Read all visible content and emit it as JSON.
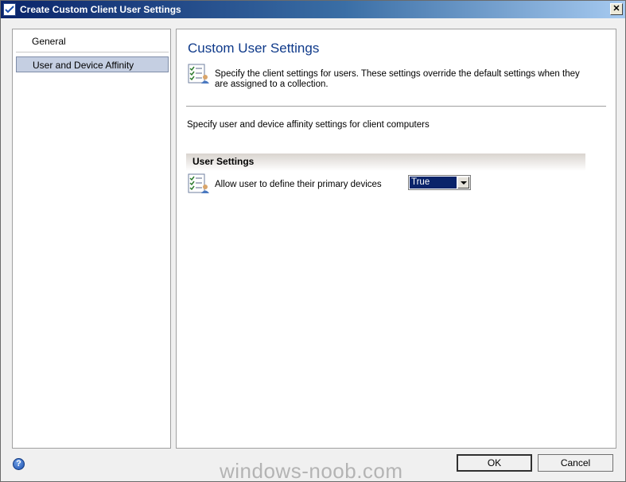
{
  "window": {
    "title": "Create Custom Client User Settings",
    "close_glyph": "✕"
  },
  "nav": {
    "items": [
      {
        "label": "General",
        "selected": false
      },
      {
        "label": "User and Device Affinity",
        "selected": true
      }
    ]
  },
  "page": {
    "title": "Custom User Settings",
    "description": "Specify the client settings for users. These settings override the default settings when they are assigned to a collection.",
    "affinity_description": "Specify user and device affinity settings for client computers"
  },
  "section": {
    "header": "User Settings",
    "settings": [
      {
        "label": "Allow user to define their primary devices",
        "value": "True"
      }
    ]
  },
  "footer": {
    "help_glyph": "?",
    "ok_label": "OK",
    "cancel_label": "Cancel",
    "watermark": "windows-noob.com"
  },
  "icons": {
    "app": "checklist-icon",
    "header": "settings-checklist-icon",
    "setting": "settings-checklist-icon",
    "help": "help-icon"
  },
  "colors": {
    "title_bar": "#0a246a",
    "page_title": "#0f3a8a",
    "nav_selected": "#c5cfe2",
    "select_highlight": "#0a246a"
  }
}
